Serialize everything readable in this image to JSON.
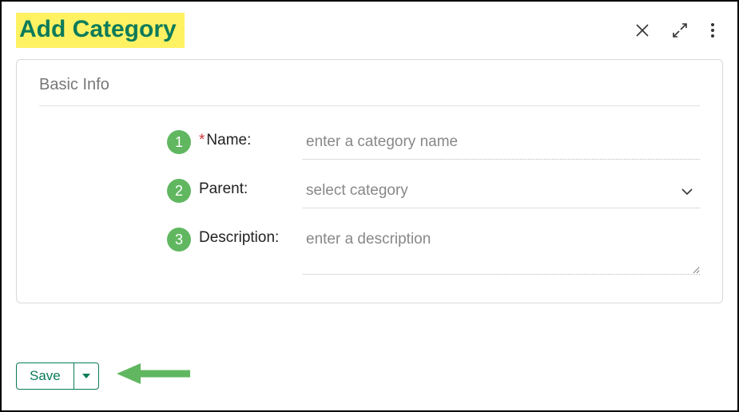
{
  "header": {
    "title": "Add Category"
  },
  "section": {
    "title": "Basic Info"
  },
  "badges": {
    "name": "1",
    "parent": "2",
    "description": "3"
  },
  "labels": {
    "name": "Name:",
    "parent": "Parent:",
    "description": "Description:",
    "required_marker": "*"
  },
  "fields": {
    "name_placeholder": "enter a category name",
    "parent_placeholder": "select category",
    "description_placeholder": "enter a description"
  },
  "footer": {
    "save_label": "Save"
  }
}
